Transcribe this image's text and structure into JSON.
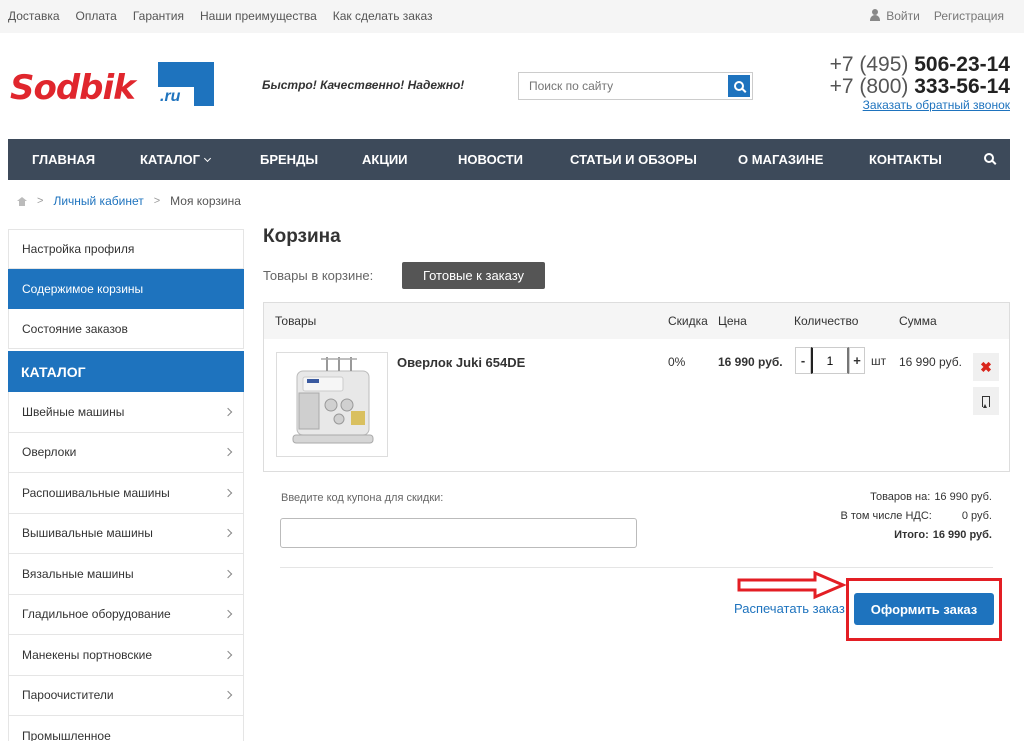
{
  "topnav": {
    "links": [
      "Доставка",
      "Оплата",
      "Гарантия",
      "Наши преимущества",
      "Как сделать заказ"
    ],
    "login": "Войти",
    "register": "Регистрация"
  },
  "header": {
    "logo_text": "Sodbik",
    "logo_suffix": ".ru",
    "slogan": "Быстро! Качественно! Надежно!",
    "search_placeholder": "Поиск по сайту",
    "phone1_prefix": "+7 (495) ",
    "phone1_number": "506-23-14",
    "phone2_prefix": "+7 (800) ",
    "phone2_number": "333-56-14",
    "callback": "Заказать обратный звонок"
  },
  "mainnav": [
    "ГЛАВНАЯ",
    "КАТАЛОГ",
    "БРЕНДЫ",
    "АКЦИИ",
    "НОВОСТИ",
    "СТАТЬИ И ОБЗОРЫ",
    "О МАГАЗИНЕ",
    "КОНТАКТЫ"
  ],
  "breadcrumb": {
    "link": "Личный кабинет",
    "current": "Моя корзина"
  },
  "sidebar": {
    "account_items": [
      "Настройка профиля",
      "Содержимое корзины",
      "Состояние заказов"
    ],
    "catalog_title": "КАТАЛОГ",
    "catalog_items": [
      "Швейные машины",
      "Оверлоки",
      "Распошивальные машины",
      "Вышивальные машины",
      "Вязальные машины",
      "Гладильное оборудование",
      "Манекены портновские",
      "Пароочистители",
      "Промышленное"
    ]
  },
  "cart": {
    "title": "Корзина",
    "items_label": "Товары в корзине:",
    "tab_ready": "Готовые к заказу",
    "columns": {
      "products": "Товары",
      "discount": "Скидка",
      "price": "Цена",
      "quantity": "Количество",
      "sum": "Сумма"
    },
    "item": {
      "name": "Оверлок Juki 654DE",
      "discount": "0%",
      "price": "16 990 руб.",
      "quantity": "1",
      "unit": "шт",
      "sum": "16 990 руб."
    },
    "coupon_label": "Введите код купона для скидки:",
    "totals": {
      "goods_label": "Товаров на:",
      "goods_value": "16 990 руб.",
      "vat_label": "В том числе НДС:",
      "vat_value": "0 руб.",
      "total_label": "Итого:",
      "total_value": "16 990 руб."
    },
    "print_link": "Распечатать заказ",
    "checkout": "Оформить заказ"
  },
  "colors": {
    "accent": "#1e73be",
    "nav_bg": "#3d4a5a",
    "logo_red": "#e0262d",
    "highlight": "#e31e24"
  }
}
